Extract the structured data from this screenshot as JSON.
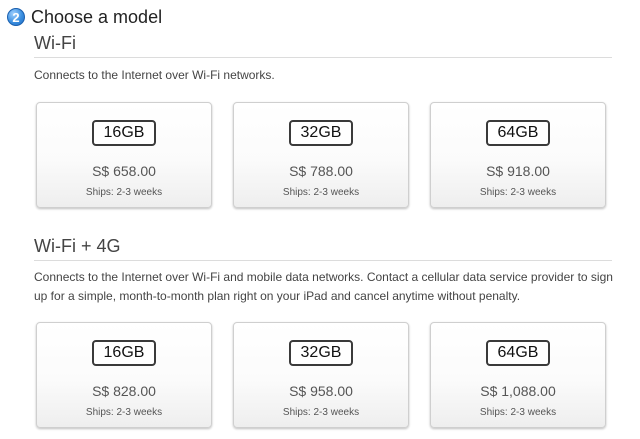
{
  "step": {
    "number": "2",
    "title": "Choose a model"
  },
  "sections": [
    {
      "title": "Wi-Fi",
      "description": "Connects to the Internet over Wi-Fi networks.",
      "models": [
        {
          "capacity": "16GB",
          "price": "S$ 658.00",
          "ships": "Ships: 2-3 weeks"
        },
        {
          "capacity": "32GB",
          "price": "S$ 788.00",
          "ships": "Ships: 2-3 weeks"
        },
        {
          "capacity": "64GB",
          "price": "S$ 918.00",
          "ships": "Ships: 2-3 weeks"
        }
      ]
    },
    {
      "title": "Wi-Fi + 4G",
      "description": "Connects to the Internet over Wi-Fi and mobile data networks. Contact a cellular data service provider to sign up for a simple, month-to-month plan right on your iPad and cancel anytime without penalty.",
      "models": [
        {
          "capacity": "16GB",
          "price": "S$ 828.00",
          "ships": "Ships: 2-3 weeks"
        },
        {
          "capacity": "32GB",
          "price": "S$ 958.00",
          "ships": "Ships: 2-3 weeks"
        },
        {
          "capacity": "64GB",
          "price": "S$ 1,088.00",
          "ships": "Ships: 2-3 weeks"
        }
      ]
    }
  ]
}
